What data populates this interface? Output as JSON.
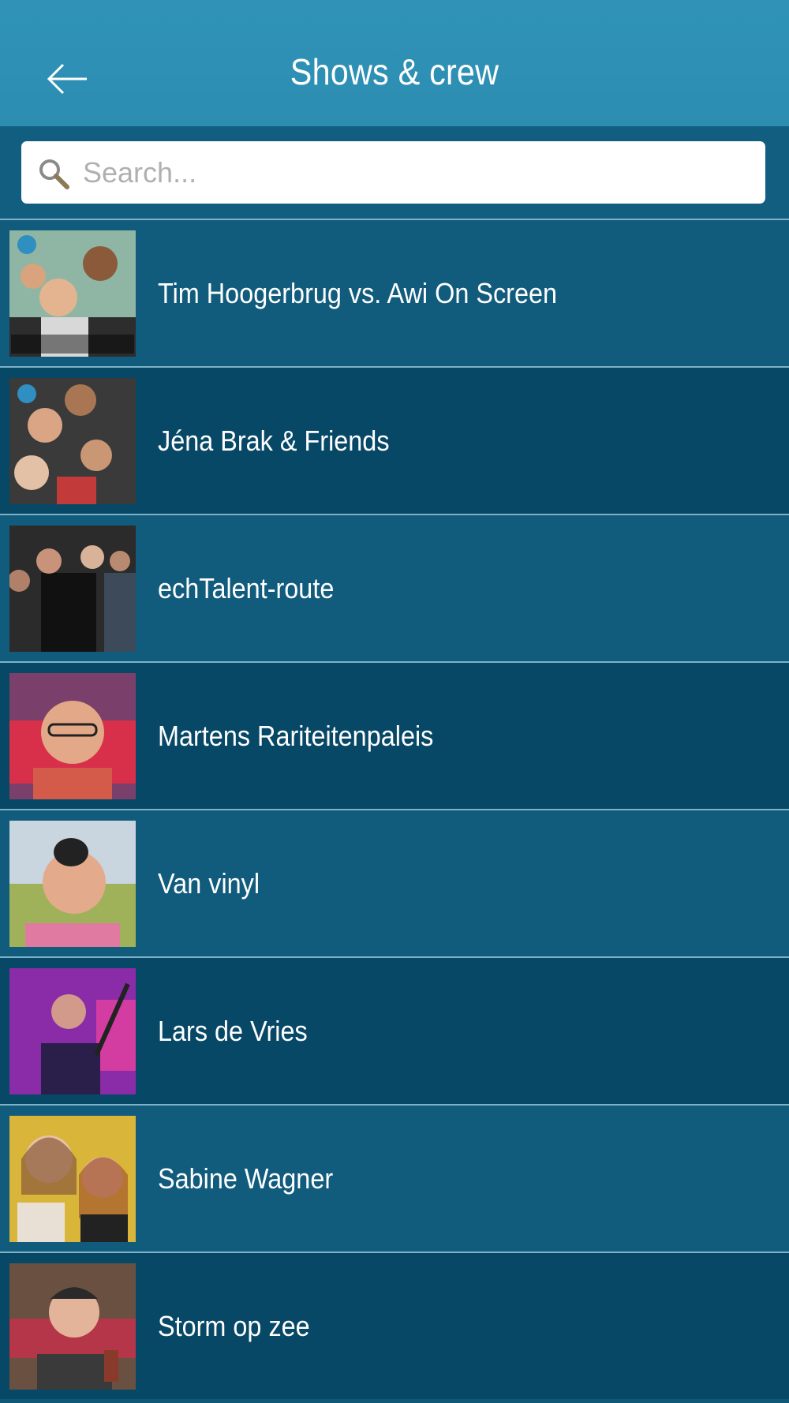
{
  "header": {
    "title": "Shows & crew",
    "back_icon": "arrow-left-icon"
  },
  "search": {
    "placeholder": "Search...",
    "value": "",
    "icon": "search-icon"
  },
  "items": [
    {
      "label": "Tim Hoogerbrug vs. Awi On Screen"
    },
    {
      "label": "Jéna Brak & Friends"
    },
    {
      "label": "echTalent-route"
    },
    {
      "label": "Martens Rariteitenpaleis"
    },
    {
      "label": "Van vinyl"
    },
    {
      "label": "Lars de Vries"
    },
    {
      "label": "Sabine Wagner"
    },
    {
      "label": "Storm op zee"
    }
  ],
  "colors": {
    "header": "#2f93b7",
    "row_light": "#115b7c",
    "row_dark": "#074866",
    "divider": "#7fb2c7"
  }
}
